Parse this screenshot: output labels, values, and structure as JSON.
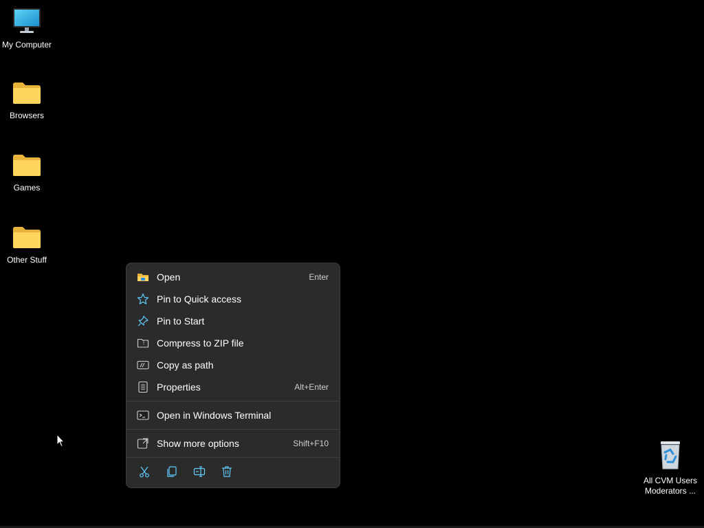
{
  "desktop": {
    "icons": [
      {
        "label": "My Computer",
        "icon": "monitor-icon"
      },
      {
        "label": "Browsers",
        "icon": "folder-icon"
      },
      {
        "label": "Games",
        "icon": "folder-icon"
      },
      {
        "label": "Other Stuff",
        "icon": "folder-icon"
      },
      {
        "label": "All CVM Users Moderators ...",
        "icon": "recycle-bin-icon"
      }
    ]
  },
  "context_menu": {
    "items": [
      {
        "label": "Open",
        "shortcut": "Enter",
        "icon": "folder-open-icon"
      },
      {
        "label": "Pin to Quick access",
        "shortcut": "",
        "icon": "star-icon"
      },
      {
        "label": "Pin to Start",
        "shortcut": "",
        "icon": "pin-icon"
      },
      {
        "label": "Compress to ZIP file",
        "shortcut": "",
        "icon": "zip-icon"
      },
      {
        "label": "Copy as path",
        "shortcut": "",
        "icon": "path-icon"
      },
      {
        "label": "Properties",
        "shortcut": "Alt+Enter",
        "icon": "properties-icon"
      },
      {
        "label": "Open in Windows Terminal",
        "shortcut": "",
        "icon": "terminal-icon"
      },
      {
        "label": "Show more options",
        "shortcut": "Shift+F10",
        "icon": "more-options-icon"
      }
    ],
    "toolbar": [
      "cut-icon",
      "copy-icon",
      "rename-icon",
      "delete-icon"
    ]
  },
  "colors": {
    "desktop_bg": "#000000",
    "menu_bg": "#2b2b2b",
    "icon_accent": "#60cdff",
    "folder_yellow": "#ffd55c"
  }
}
